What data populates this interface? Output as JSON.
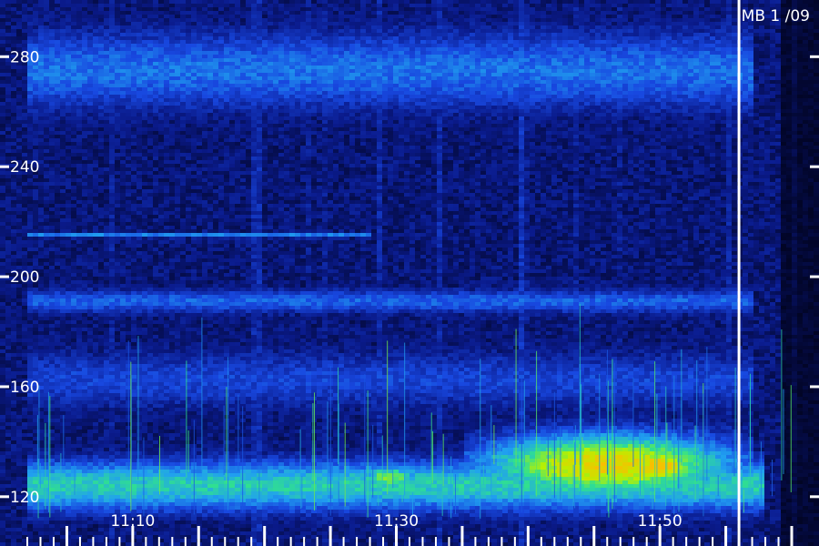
{
  "chart_data": {
    "type": "heatmap",
    "title": "MB 1 /09",
    "y_ticks": [
      {
        "value": 120,
        "label": "120"
      },
      {
        "value": 160,
        "label": "160"
      },
      {
        "value": 200,
        "label": "200"
      },
      {
        "value": 240,
        "label": "240"
      },
      {
        "value": 280,
        "label": "280"
      }
    ],
    "x_ticks": [
      {
        "value": "11:10",
        "label": "11:10"
      },
      {
        "value": "11:30",
        "label": "11:30"
      },
      {
        "value": "11:50",
        "label": "11:50"
      }
    ],
    "ylim": [
      112,
      294
    ],
    "xlim": [
      "11:02",
      "12:00"
    ],
    "colormap": [
      "#000010",
      "#0a1a8a",
      "#1848e0",
      "#20a0f0",
      "#30e090",
      "#b8f000",
      "#f8c000"
    ],
    "marker_line": {
      "time": "11:56",
      "color": "#ffffff"
    },
    "intensity_features": [
      {
        "kind": "band",
        "t_start": "11:02",
        "t_end": "11:58",
        "f_low": 113,
        "f_high": 135,
        "level": 0.55
      },
      {
        "kind": "blob",
        "t_start": "11:35",
        "t_end": "11:57",
        "f_low": 118,
        "f_high": 145,
        "level": 0.9
      },
      {
        "kind": "blob",
        "t_start": "11:47",
        "t_end": "11:53",
        "f_low": 124,
        "f_high": 138,
        "level": 1.0
      },
      {
        "kind": "blob",
        "t_start": "11:27",
        "t_end": "11:32",
        "f_low": 122,
        "f_high": 132,
        "level": 0.72
      },
      {
        "kind": "band",
        "t_start": "11:02",
        "t_end": "11:57",
        "f_low": 258,
        "f_high": 292,
        "level": 0.35
      },
      {
        "kind": "band",
        "t_start": "11:02",
        "t_end": "11:28",
        "f_low": 214,
        "f_high": 216,
        "level": 0.4
      },
      {
        "kind": "band",
        "t_start": "11:02",
        "t_end": "11:57",
        "f_low": 186,
        "f_high": 196,
        "level": 0.32
      },
      {
        "kind": "band",
        "t_start": "11:02",
        "t_end": "11:57",
        "f_low": 150,
        "f_high": 175,
        "level": 0.25
      }
    ]
  }
}
